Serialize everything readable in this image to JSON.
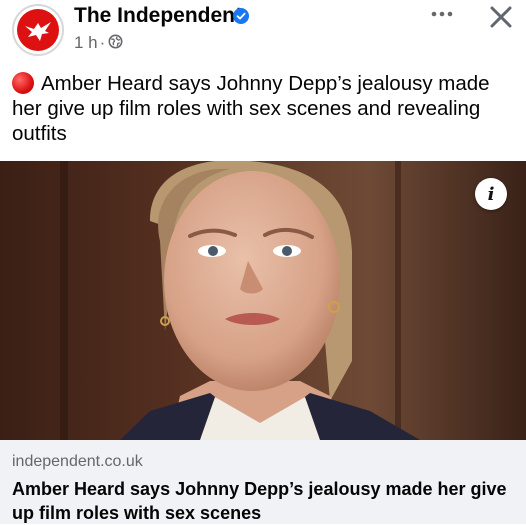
{
  "post": {
    "page_name": "The Independent",
    "time": "1 h",
    "separator": "·",
    "audience_icon": "globe-icon",
    "verified_icon": "verified-badge-icon",
    "more_icon": "more-options-icon",
    "close_icon": "close-icon",
    "caption_icon": "red-circle-emoji",
    "caption": "Amber Heard says Johnny Depp’s jealousy made her give up film roles with sex scenes and revealing outfits"
  },
  "media": {
    "info_icon": "info-icon",
    "info_glyph": "i"
  },
  "link_preview": {
    "domain": "independent.co.uk",
    "title": "Amber Heard says Johnny Depp’s jealousy made her give up film roles with sex scenes"
  },
  "colors": {
    "brand_red": "#dd1111",
    "verified_blue": "#1877f2",
    "meta_gray": "#65676b",
    "card_bg": "#f0f2f5"
  }
}
